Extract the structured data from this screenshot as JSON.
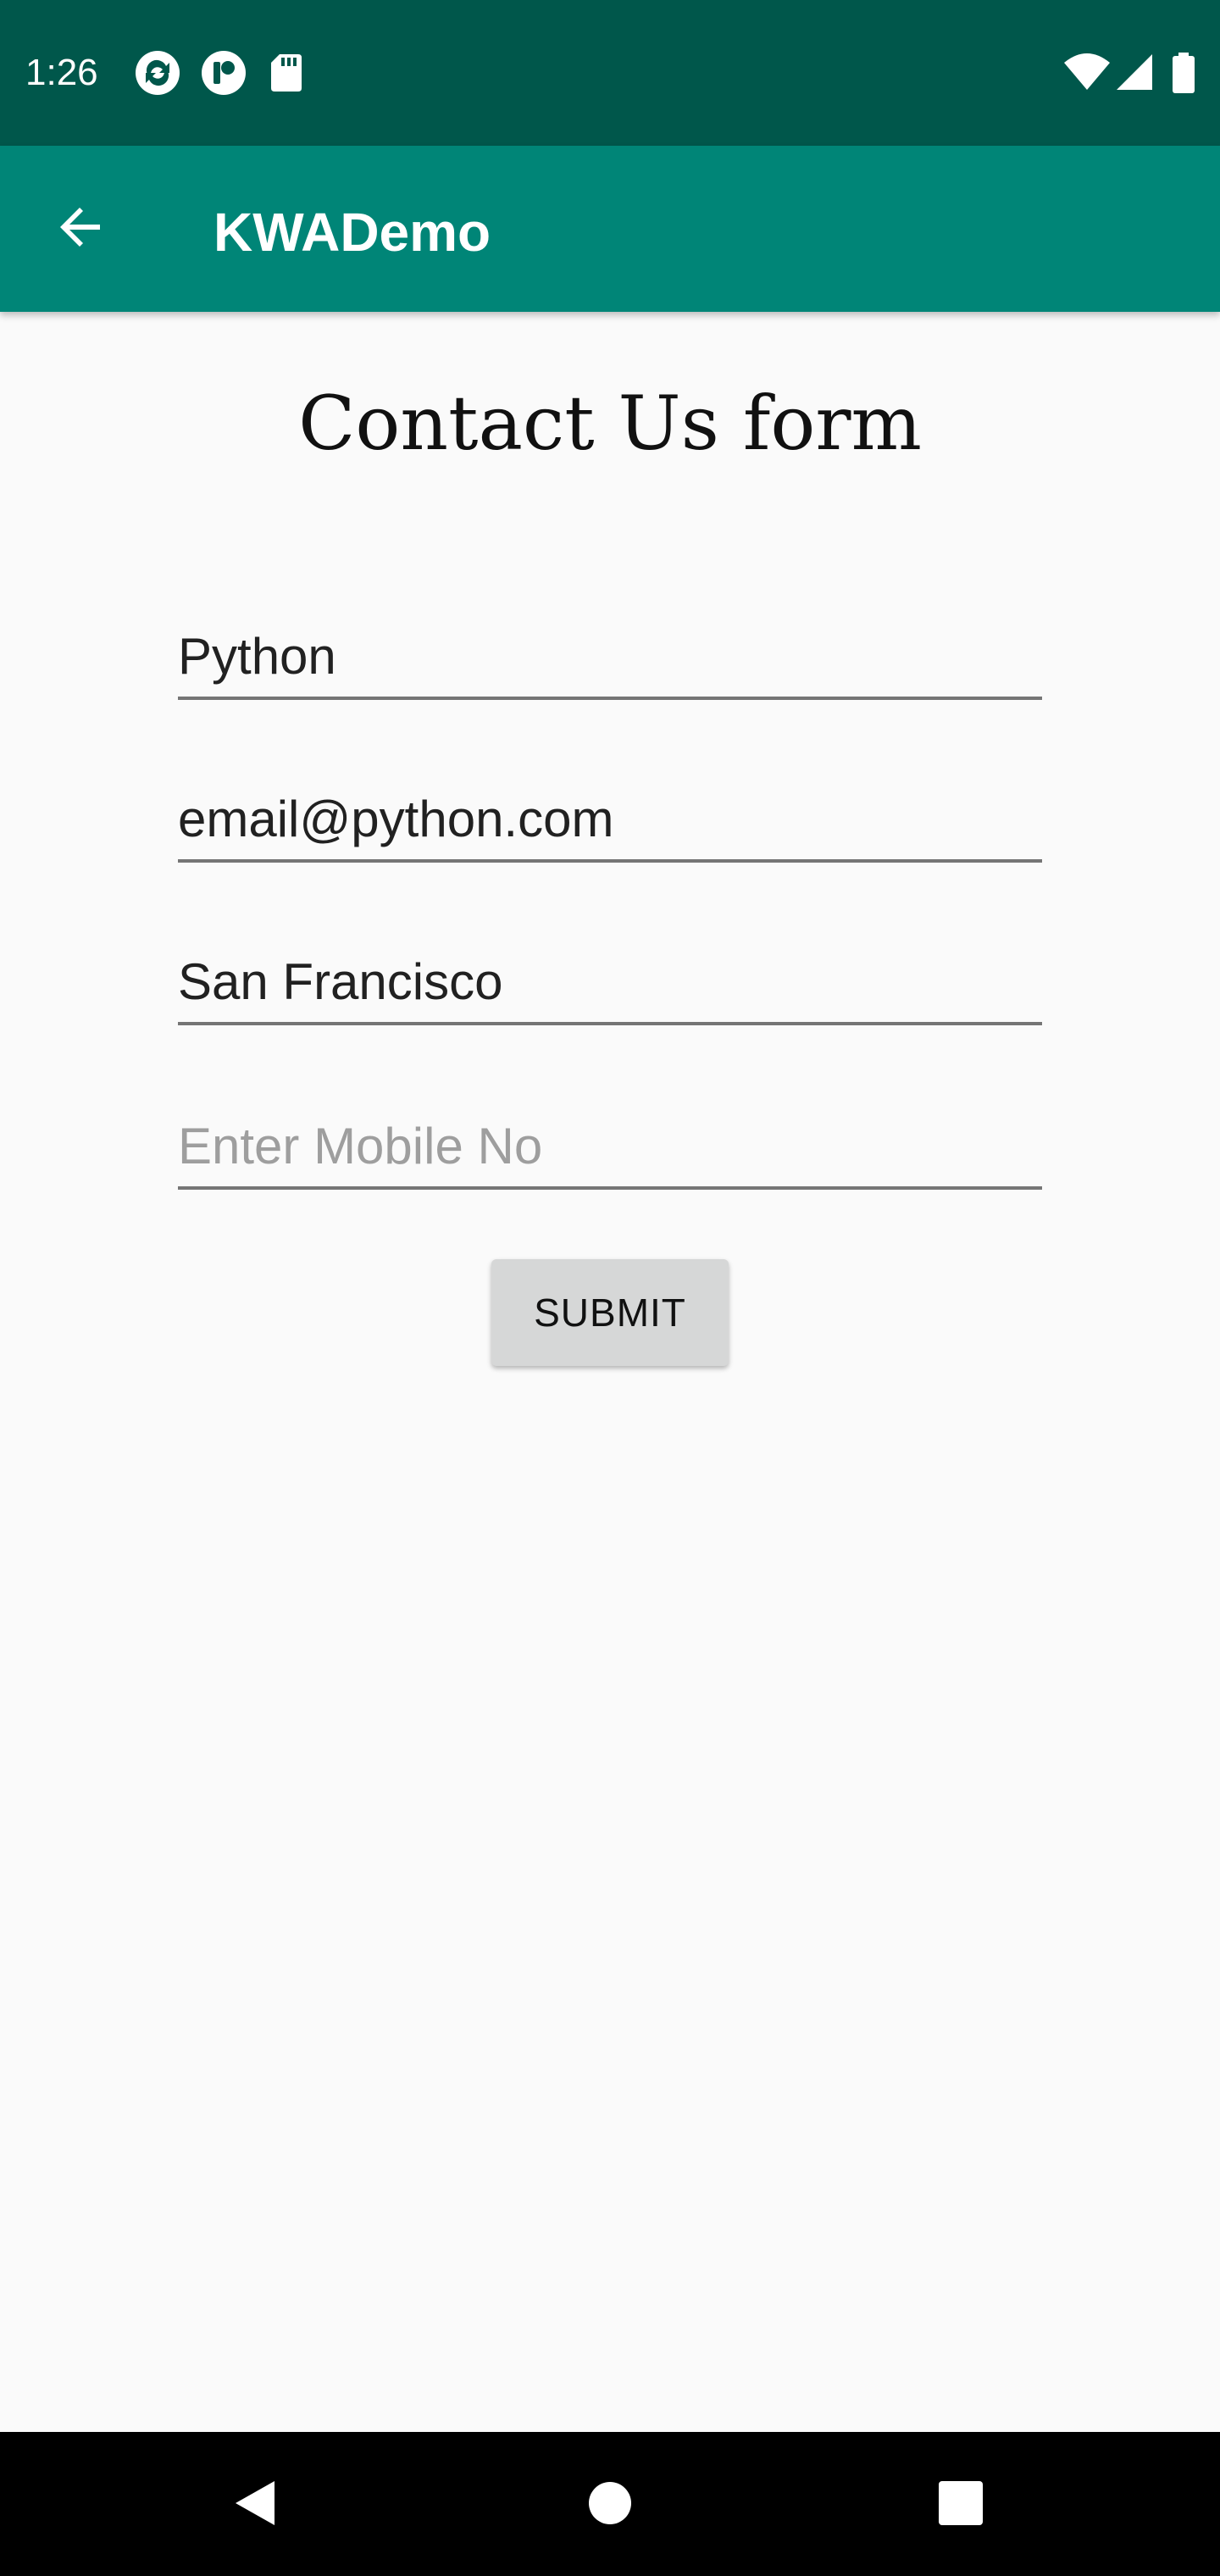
{
  "status_bar": {
    "time": "1:26",
    "icons": [
      "sync-app-icon",
      "notification-app-icon",
      "sd-card-icon",
      "wifi-icon",
      "cell-signal-icon",
      "battery-icon"
    ],
    "background_color": "#00574b"
  },
  "app_bar": {
    "title": "KWADemo",
    "back_icon": "arrow-back-icon",
    "background_color": "#008577"
  },
  "form": {
    "title": "Contact Us form",
    "name_field": {
      "value": "Python",
      "placeholder": ""
    },
    "email_field": {
      "value": "email@python.com",
      "placeholder": ""
    },
    "city_field": {
      "value": "San Francisco",
      "placeholder": ""
    },
    "mobile_field": {
      "value": "",
      "placeholder": "Enter Mobile No"
    },
    "submit_label": "SUBMIT"
  },
  "nav_bar": {
    "icons": [
      "back-triangle-icon",
      "home-circle-icon",
      "recents-square-icon"
    ]
  }
}
